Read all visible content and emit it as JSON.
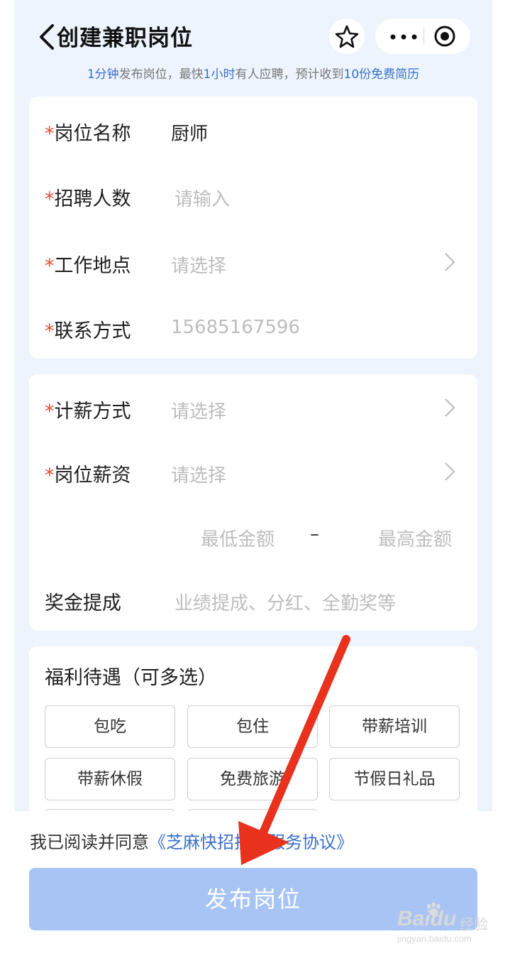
{
  "header": {
    "title": "创建兼职岗位",
    "subtitle_parts": [
      "1分钟",
      "发布岗位，最快",
      "1小时",
      "有人应聘，预计收到",
      "10份免费简历"
    ]
  },
  "form_basic": {
    "rows": [
      {
        "label": "岗位名称",
        "value": "厨师",
        "required": true
      },
      {
        "label": "招聘人数",
        "placeholder": "请输入",
        "required": true
      },
      {
        "label": "工作地点",
        "placeholder": "请选择",
        "required": true
      },
      {
        "label": "联系方式",
        "placeholder": "15685167596",
        "required": true
      }
    ]
  },
  "form_salary": {
    "rows": [
      {
        "label": "计薪方式",
        "placeholder": "请选择",
        "required": true
      },
      {
        "label": "岗位薪资",
        "placeholder": "请选择",
        "required": true
      }
    ],
    "min_placeholder": "最低金额",
    "dash": "–",
    "max_placeholder": "最高金额",
    "bonus_label": "奖金提成",
    "bonus_placeholder": "业绩提成、分红、全勤奖等"
  },
  "benefits": {
    "title": "福利待遇（可多选）",
    "tags": [
      "包吃",
      "包住",
      "带薪培训",
      "带薪休假",
      "免费旅游",
      "节假日礼品"
    ]
  },
  "footer": {
    "agree_prefix": "我已阅读并同意",
    "agree_link": "《芝麻快招技术服务协议》",
    "publish_label": "发布岗位"
  },
  "required_mark": "*",
  "watermark": {
    "brand": "Baidu",
    "cn": "经验",
    "url": "jingyan.baidu.com"
  },
  "colors": {
    "accent": "#3b6fc6",
    "required": "#e34b3c",
    "publish_bg": "#a7c4f5",
    "page_bg": "#edf4fd",
    "arrow": "#e8321e"
  }
}
